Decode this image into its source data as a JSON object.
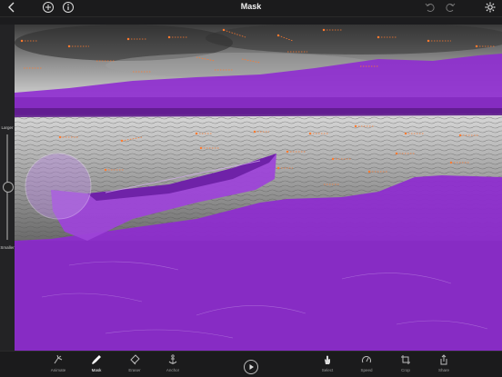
{
  "header": {
    "title": "Mask"
  },
  "sidebar": {
    "larger_label": "Larger",
    "smaller_label": "Smaller"
  },
  "toolbar": {
    "tools": [
      {
        "label": "Animate",
        "icon": "animate-icon"
      },
      {
        "label": "Mask",
        "icon": "mask-brush-icon",
        "active": true
      },
      {
        "label": "Eraser",
        "icon": "eraser-icon"
      },
      {
        "label": "Anchor",
        "icon": "anchor-icon"
      },
      {
        "label": "Select",
        "icon": "hand-icon"
      },
      {
        "label": "Speed",
        "icon": "speedometer-icon"
      },
      {
        "label": "Crop",
        "icon": "crop-icon"
      },
      {
        "label": "Share",
        "icon": "share-icon"
      }
    ]
  },
  "colors": {
    "mask": "#8e2bd0",
    "motion_arrow": "#ff7a2e",
    "background": "#1c1c1e"
  },
  "brush_size": 0.55
}
